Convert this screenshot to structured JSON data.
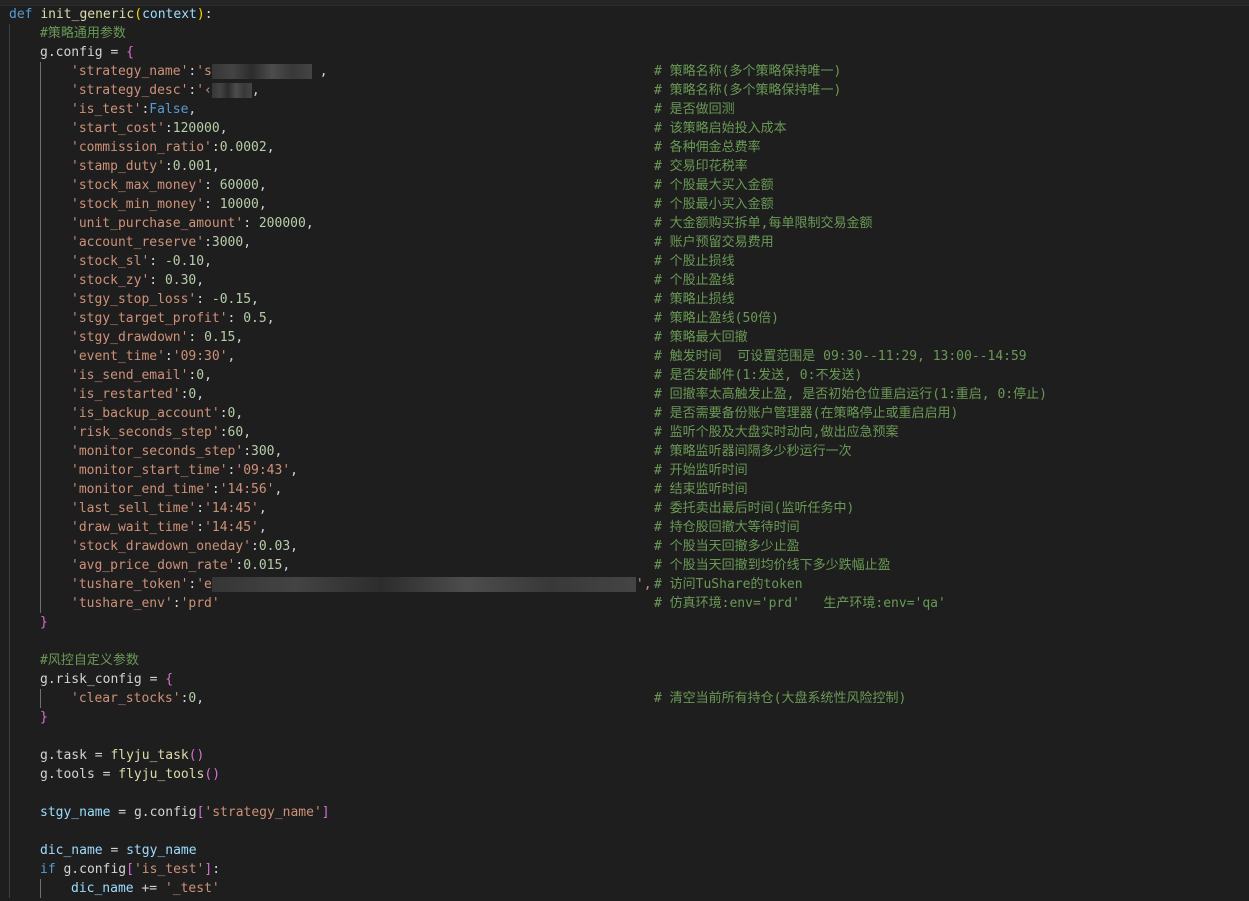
{
  "editor": {
    "def_keyword": "def",
    "func_name": "init_generic",
    "param": "context",
    "comment_general": "#策略通用参数",
    "g_config": "g.config",
    "comment_risk": "#风控自定义参数",
    "g_risk_config": "g.risk_config",
    "assign_op": " = ",
    "open_brace": "{",
    "close_brace": "}",
    "config_items": [
      {
        "key": "'strategy_name'",
        "sep": ":",
        "value": "'s",
        "value_type": "str",
        "redacted": true,
        "redact_width": 100,
        "tail": " ,",
        "comment": "# 策略名称(多个策略保持唯一)"
      },
      {
        "key": "'strategy_desc'",
        "sep": ":",
        "value": "'‹",
        "value_type": "str",
        "redacted": true,
        "redact_width": 40,
        "tail": ",",
        "comment": "# 策略名称(多个策略保持唯一)"
      },
      {
        "key": "'is_test'",
        "sep": ":",
        "value": "False",
        "value_type": "kw",
        "tail": ",",
        "comment": "# 是否做回测"
      },
      {
        "key": "'start_cost'",
        "sep": ":",
        "value": "120000",
        "value_type": "num",
        "tail": ",",
        "comment": "# 该策略启始投入成本"
      },
      {
        "key": "'commission_ratio'",
        "sep": ":",
        "value": "0.0002",
        "value_type": "num",
        "tail": ",",
        "comment": "# 各种佣金总费率"
      },
      {
        "key": "'stamp_duty'",
        "sep": ":",
        "value": "0.001",
        "value_type": "num",
        "tail": ",",
        "comment": "# 交易印花税率"
      },
      {
        "key": "'stock_max_money'",
        "sep": ": ",
        "value": "60000",
        "value_type": "num",
        "tail": ",",
        "comment": "# 个股最大买入金额"
      },
      {
        "key": "'stock_min_money'",
        "sep": ": ",
        "value": "10000",
        "value_type": "num",
        "tail": ",",
        "comment": "# 个股最小买入金额"
      },
      {
        "key": "'unit_purchase_amount'",
        "sep": ": ",
        "value": "200000",
        "value_type": "num",
        "tail": ",",
        "comment": "# 大金额购买拆单,每单限制交易金额"
      },
      {
        "key": "'account_reserve'",
        "sep": ":",
        "value": "3000",
        "value_type": "num",
        "tail": ",",
        "comment": "# 账户预留交易费用"
      },
      {
        "key": "'stock_sl'",
        "sep": ": ",
        "value": "-0.10",
        "value_type": "num",
        "tail": ",",
        "comment": "# 个股止损线"
      },
      {
        "key": "'stock_zy'",
        "sep": ": ",
        "value": "0.30",
        "value_type": "num",
        "tail": ",",
        "comment": "# 个股止盈线"
      },
      {
        "key": "'stgy_stop_loss'",
        "sep": ": ",
        "value": "-0.15",
        "value_type": "num",
        "tail": ",",
        "comment": "# 策略止损线"
      },
      {
        "key": "'stgy_target_profit'",
        "sep": ": ",
        "value": "0.5",
        "value_type": "num",
        "tail": ",",
        "comment": "# 策略止盈线(50倍)"
      },
      {
        "key": "'stgy_drawdown'",
        "sep": ": ",
        "value": "0.15",
        "value_type": "num",
        "tail": ",",
        "comment": "# 策略最大回撤"
      },
      {
        "key": "'event_time'",
        "sep": ":",
        "value": "'09:30'",
        "value_type": "str",
        "tail": ",",
        "comment": "# 触发时间  可设置范围是 09:30--11:29, 13:00--14:59"
      },
      {
        "key": "'is_send_email'",
        "sep": ":",
        "value": "0",
        "value_type": "num",
        "tail": ",",
        "comment": "# 是否发邮件(1:发送, 0:不发送)"
      },
      {
        "key": "'is_restarted'",
        "sep": ":",
        "value": "0",
        "value_type": "num",
        "tail": ",",
        "comment": "# 回撤率太高触发止盈, 是否初始仓位重启运行(1:重启, 0:停止)"
      },
      {
        "key": "'is_backup_account'",
        "sep": ":",
        "value": "0",
        "value_type": "num",
        "tail": ",",
        "comment": "# 是否需要备份账户管理器(在策略停止或重启启用)"
      },
      {
        "key": "'risk_seconds_step'",
        "sep": ":",
        "value": "60",
        "value_type": "num",
        "tail": ",",
        "comment": "# 监听个股及大盘实时动向,做出应急预案"
      },
      {
        "key": "'monitor_seconds_step'",
        "sep": ":",
        "value": "300",
        "value_type": "num",
        "tail": ",",
        "comment": "# 策略监听器间隔多少秒运行一次"
      },
      {
        "key": "'monitor_start_time'",
        "sep": ":",
        "value": "'09:43'",
        "value_type": "str",
        "tail": ",",
        "comment": "# 开始监听时间"
      },
      {
        "key": "'monitor_end_time'",
        "sep": ":",
        "value": "'14:56'",
        "value_type": "str",
        "tail": ",",
        "comment": "# 结束监听时间"
      },
      {
        "key": "'last_sell_time'",
        "sep": ":",
        "value": "'14:45'",
        "value_type": "str",
        "tail": ",",
        "comment": "# 委托卖出最后时间(监听任务中)"
      },
      {
        "key": "'draw_wait_time'",
        "sep": ":",
        "value": "'14:45'",
        "value_type": "str",
        "tail": ",",
        "comment": "# 持仓股回撤大等待时间"
      },
      {
        "key": "'stock_drawdown_oneday'",
        "sep": ":",
        "value": "0.03",
        "value_type": "num",
        "tail": ",",
        "comment": "# 个股当天回撤多少止盈"
      },
      {
        "key": "'avg_price_down_rate'",
        "sep": ":",
        "value": "0.015",
        "value_type": "num",
        "tail": ",",
        "comment": "# 个股当天回撤到均价线下多少跌幅止盈"
      },
      {
        "key": "'tushare_token'",
        "sep": ":",
        "value": "'e",
        "value_type": "str",
        "redacted": true,
        "redact_width": 424,
        "tail": "',",
        "comment": "# 访问TuShare的token"
      },
      {
        "key": "'tushare_env'",
        "sep": ":",
        "value": "'prd'",
        "value_type": "str",
        "tail": "",
        "comment": "# 仿真环境:env='prd'   生产环境:env='qa'"
      }
    ],
    "risk_items": [
      {
        "key": "'clear_stocks'",
        "sep": ":",
        "value": "0",
        "value_type": "num",
        "tail": ",",
        "comment": "# 清空当前所有持仓(大盘系统性风险控制)"
      }
    ],
    "task_line": {
      "lhs": "g.task",
      "func": "flyju_task"
    },
    "tools_line": {
      "lhs": "g.tools",
      "func": "flyju_tools"
    },
    "stgy_line": {
      "lhs": "stgy_name",
      "obj": "g.config",
      "key": "'strategy_name'"
    },
    "dic_line": {
      "lhs": "dic_name",
      "rhs": "stgy_name"
    },
    "if_line": {
      "kw": "if",
      "obj": "g.config",
      "key": "'is_test'"
    },
    "append_line": {
      "lhs": "dic_name",
      "op": " += ",
      "value": "'_test'"
    }
  }
}
